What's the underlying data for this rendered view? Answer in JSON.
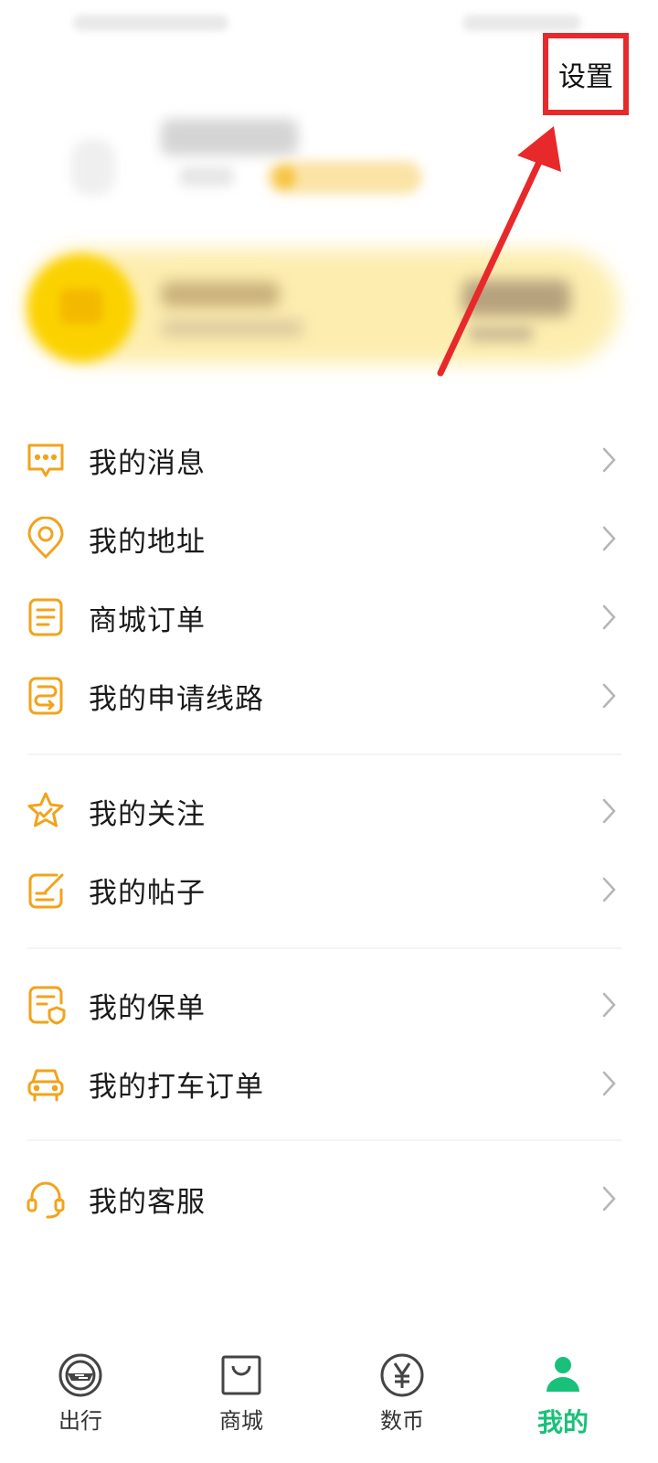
{
  "header": {
    "settings_label": "设置"
  },
  "menu": {
    "group1": [
      {
        "label": "我的消息",
        "icon": "message-icon"
      },
      {
        "label": "我的地址",
        "icon": "location-icon"
      },
      {
        "label": "商城订单",
        "icon": "order-icon"
      },
      {
        "label": "我的申请线路",
        "icon": "route-icon"
      }
    ],
    "group2": [
      {
        "label": "我的关注",
        "icon": "star-icon"
      },
      {
        "label": "我的帖子",
        "icon": "post-icon"
      }
    ],
    "group3": [
      {
        "label": "我的保单",
        "icon": "policy-icon"
      },
      {
        "label": "我的打车订单",
        "icon": "car-icon"
      }
    ],
    "group4": [
      {
        "label": "我的客服",
        "icon": "headset-icon"
      }
    ]
  },
  "tabs": [
    {
      "label": "出行",
      "icon": "travel-icon",
      "active": false
    },
    {
      "label": "商城",
      "icon": "shopping-bag-icon",
      "active": false
    },
    {
      "label": "数币",
      "icon": "yuan-coin-icon",
      "active": false
    },
    {
      "label": "我的",
      "icon": "profile-icon",
      "active": true
    }
  ],
  "colors": {
    "accent": "#f2a31b",
    "highlight": "#e8292b",
    "active_tab": "#19c07a"
  }
}
